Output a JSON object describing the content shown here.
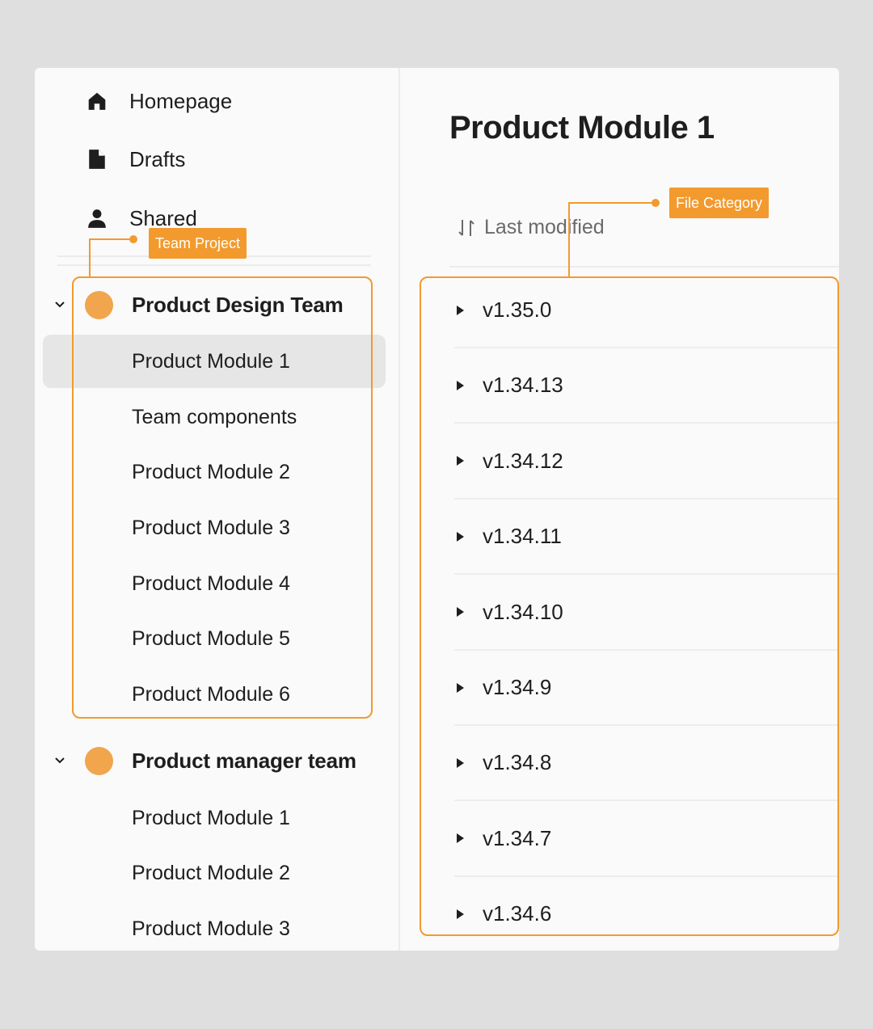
{
  "nav": {
    "items": [
      {
        "label": "Homepage",
        "icon": "home-icon"
      },
      {
        "label": "Drafts",
        "icon": "file-icon"
      },
      {
        "label": "Shared",
        "icon": "person-icon"
      }
    ]
  },
  "teams": [
    {
      "name": "Product Design Team",
      "color": "#f1a54c",
      "projects": [
        "Product Module 1",
        "Team components",
        "Product Module 2",
        "Product Module 3",
        "Product Module 4",
        "Product Module 5",
        "Product Module 6"
      ]
    },
    {
      "name": "Product manager team",
      "color": "#f1a54c",
      "projects": [
        "Product Module 1",
        "Product Module 2",
        "Product Module 3"
      ]
    }
  ],
  "main": {
    "title": "Product Module 1",
    "sort_label": "Last modified",
    "versions": [
      "v1.35.0",
      "v1.34.13",
      "v1.34.12",
      "v1.34.11",
      "v1.34.10",
      "v1.34.9",
      "v1.34.8",
      "v1.34.7",
      "v1.34.6"
    ]
  },
  "annotations": {
    "team_project": "Team Project",
    "file_category": "File Category",
    "accent": "#f29a2e"
  }
}
